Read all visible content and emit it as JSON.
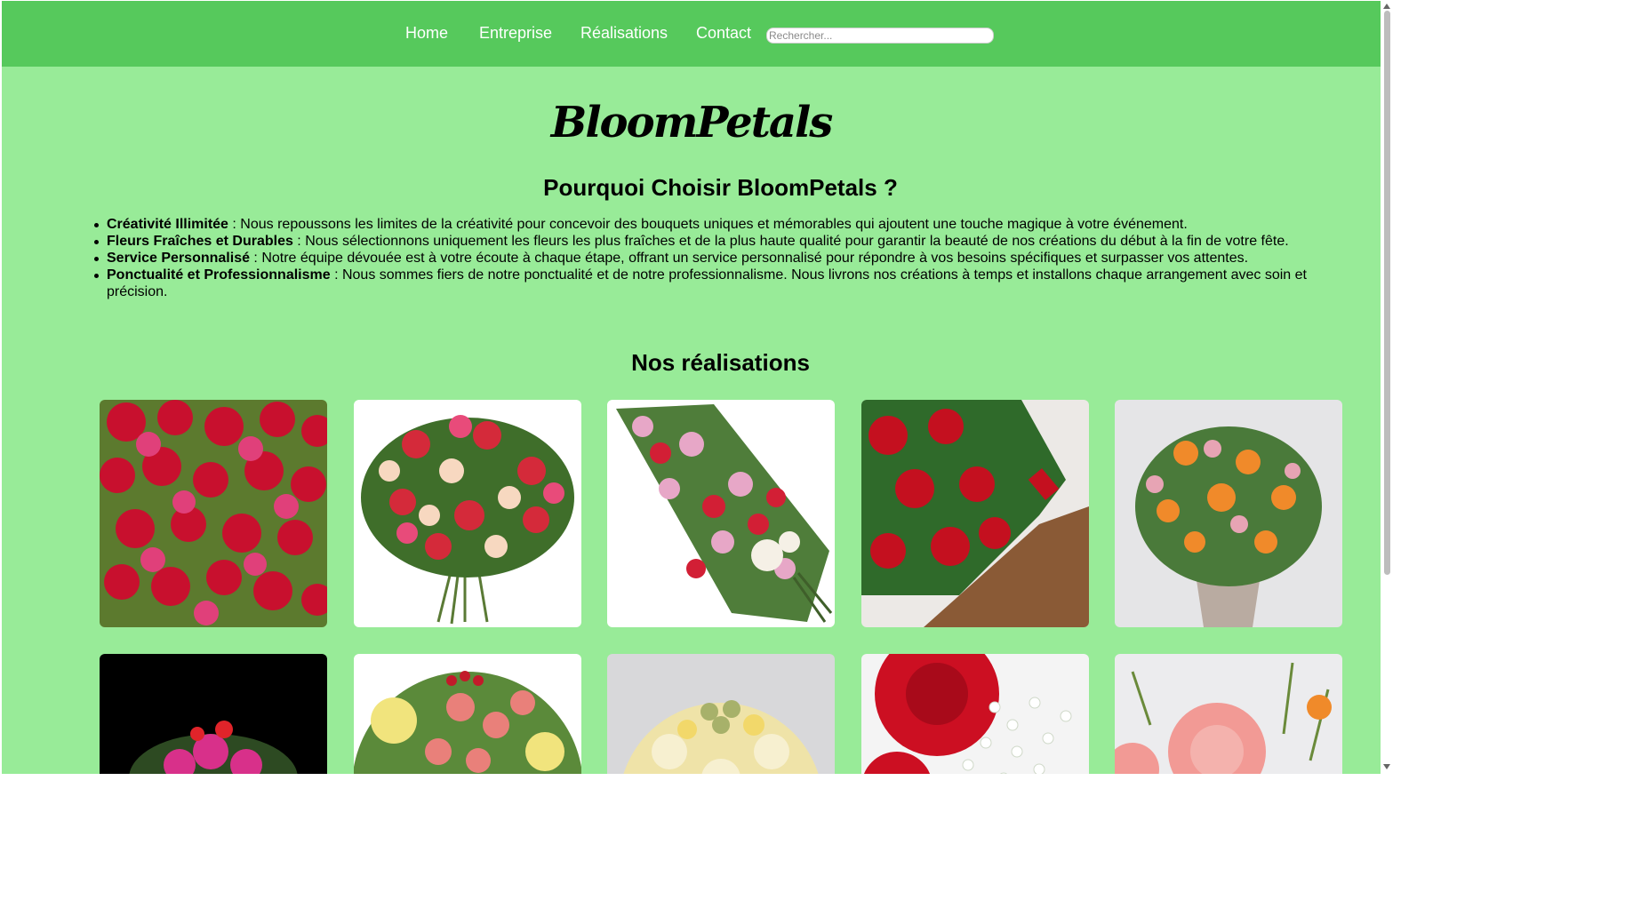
{
  "nav": {
    "links": [
      "Home",
      "Entreprise",
      "Réalisations",
      "Contact"
    ],
    "search_placeholder": "Rechercher..."
  },
  "brand": "BloomPetals",
  "why": {
    "title": "Pourquoi Choisir BloomPetals ?",
    "items": [
      {
        "term": "Créativité Illimitée",
        "desc": " : Nous repoussons les limites de la créativité pour concevoir des bouquets uniques et mémorables qui ajoutent une touche magique à votre événement."
      },
      {
        "term": "Fleurs Fraîches et Durables",
        "desc": " : Nous sélectionnons uniquement les fleurs les plus fraîches et de la plus haute qualité pour garantir la beauté de nos créations du début à la fin de votre fête."
      },
      {
        "term": "Service Personnalisé",
        "desc": " : Notre équipe dévouée est à votre écoute à chaque étape, offrant un service personnalisé pour répondre à vos besoins spécifiques et surpasser vos attentes."
      },
      {
        "term": "Ponctualité et Professionnalisme",
        "desc": " : Nous sommes fiers de notre ponctualité et de notre professionnalisme. Nous livrons nos créations à temps et installons chaque arrangement avec soin et précision."
      }
    ]
  },
  "gallery": {
    "title": "Nos réalisations"
  },
  "colors": {
    "navbar": "#56c95c",
    "page_background": "#98eb98"
  }
}
